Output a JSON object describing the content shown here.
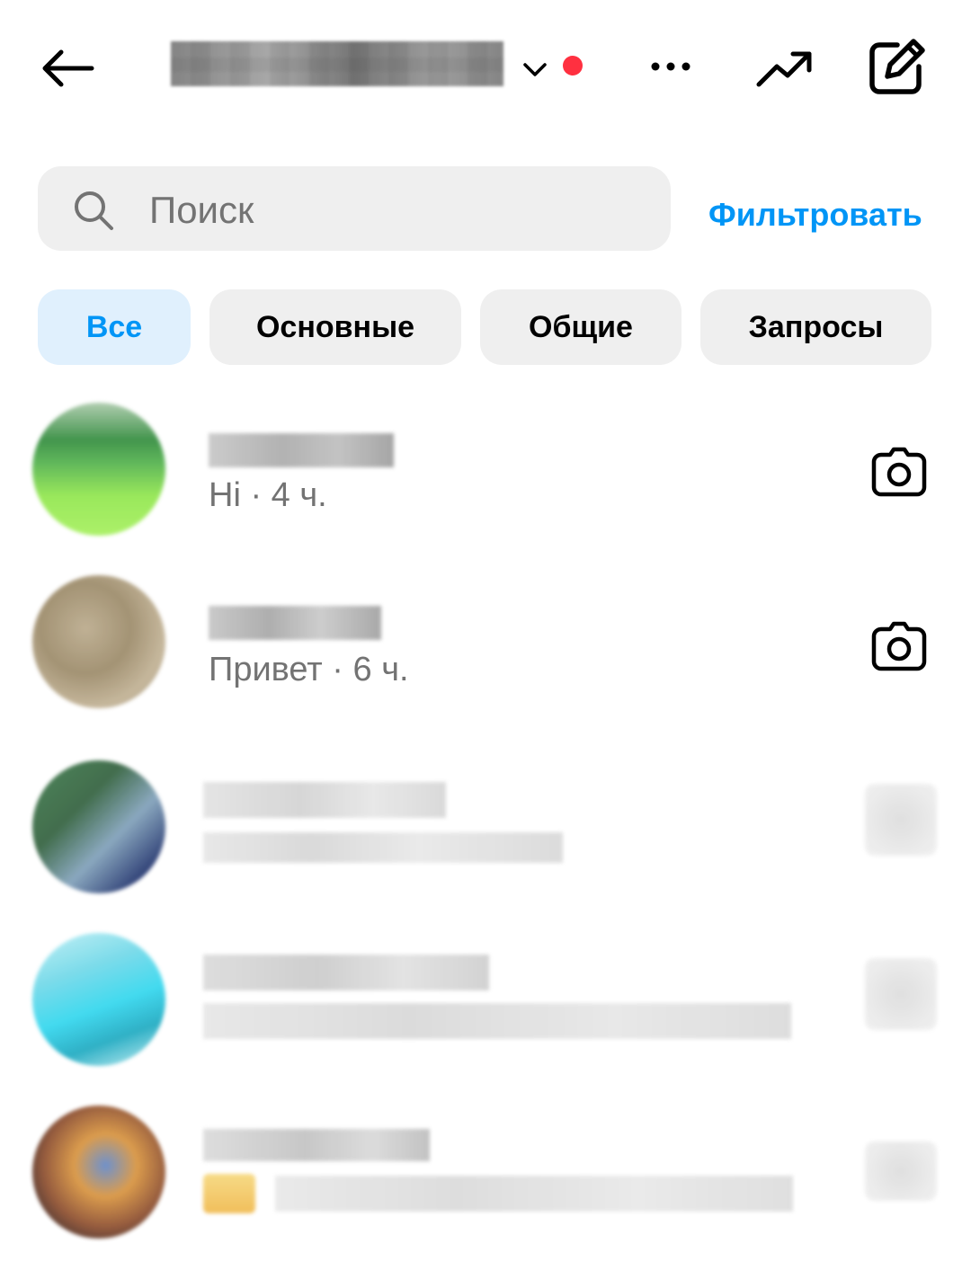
{
  "header": {
    "username": "",
    "icons": {
      "back": "arrow-left-icon",
      "chevron": "chevron-down-icon",
      "live": "live-dot",
      "more": "more-horizontal-icon",
      "trend": "trending-up-icon",
      "compose": "compose-icon"
    }
  },
  "search": {
    "placeholder": "Поиск",
    "value": ""
  },
  "filter_label": "Фильтровать",
  "chips": [
    {
      "label": "Все",
      "active": true
    },
    {
      "label": "Основные",
      "active": false
    },
    {
      "label": "Общие",
      "active": false
    },
    {
      "label": "Запросы",
      "active": false
    }
  ],
  "threads": [
    {
      "name": "",
      "message": "Hi",
      "time": "4 ч.",
      "action_icon": "camera-icon"
    },
    {
      "name": "",
      "message": "Привет",
      "time": "6 ч.",
      "action_icon": "camera-icon"
    },
    {
      "name": "",
      "message": "",
      "time": "",
      "action_icon": "camera-icon"
    },
    {
      "name": "",
      "message": "",
      "time": "",
      "action_icon": "camera-icon"
    },
    {
      "name": "",
      "message": "",
      "time": "",
      "action_icon": "camera-icon"
    }
  ],
  "colors": {
    "accent": "#0095f6",
    "chip_bg": "#efefef",
    "chip_active_bg": "#e0f0fd",
    "secondary_text": "#737373",
    "live_dot": "#ff3040"
  }
}
